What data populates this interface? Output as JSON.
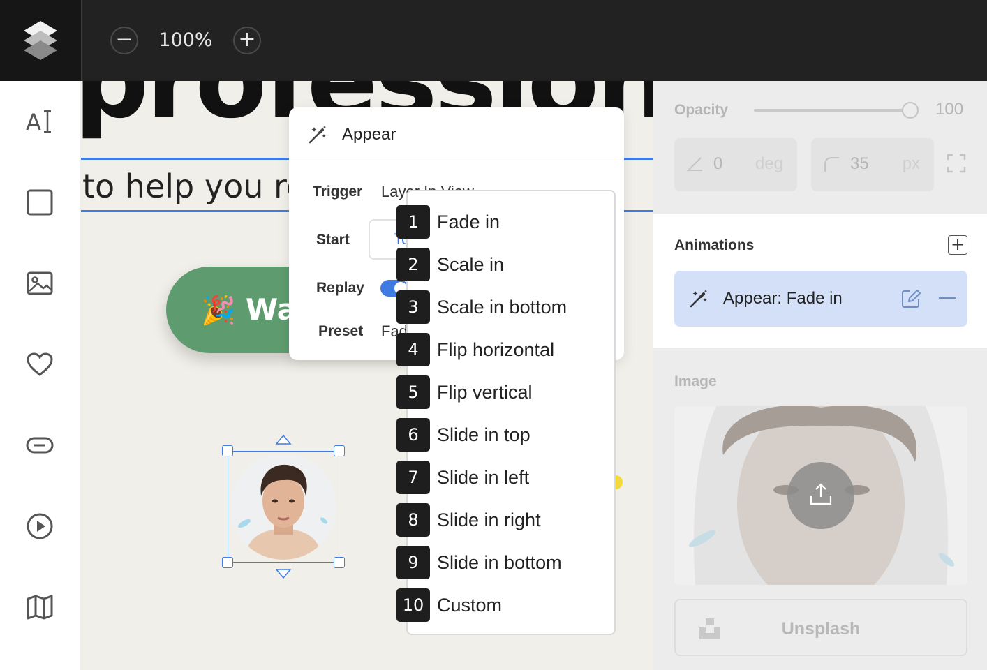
{
  "topbar": {
    "zoom_out": "−",
    "zoom_value": "100%",
    "zoom_in": "+"
  },
  "left_toolbar": {
    "tools": [
      "text-tool",
      "rectangle-tool",
      "image-tool",
      "heart-tool",
      "button-tool",
      "video-tool",
      "map-tool"
    ]
  },
  "canvas": {
    "heading": "profession",
    "subtitle": "to help you reach your goals and",
    "cta_emoji": "🎉",
    "cta_label": "Wa"
  },
  "appear_popup": {
    "title": "Appear",
    "trigger_label": "Trigger",
    "trigger_value": "Layer In View",
    "start_label": "Start",
    "start_value": "To",
    "replay_label": "Replay",
    "replay_on": true,
    "preset_label": "Preset",
    "preset_value": "Fade in"
  },
  "preset_dropdown": {
    "items": [
      {
        "num": "1",
        "label": "Fade in"
      },
      {
        "num": "2",
        "label": "Scale in"
      },
      {
        "num": "3",
        "label": "Scale in bottom"
      },
      {
        "num": "4",
        "label": "Flip horizontal"
      },
      {
        "num": "5",
        "label": "Flip vertical"
      },
      {
        "num": "6",
        "label": "Slide in top"
      },
      {
        "num": "7",
        "label": "Slide in left"
      },
      {
        "num": "8",
        "label": "Slide in right"
      },
      {
        "num": "9",
        "label": "Slide in bottom"
      },
      {
        "num": "10",
        "label": "Custom"
      }
    ]
  },
  "right_panel": {
    "opacity_label": "Opacity",
    "opacity_value": "100",
    "rotation_value": "0",
    "rotation_unit": "deg",
    "radius_value": "35",
    "radius_unit": "px",
    "animations_title": "Animations",
    "animations_add": "+",
    "animation_item": "Appear: Fade in",
    "image_label": "Image",
    "unsplash_label": "Unsplash"
  },
  "colors": {
    "accent": "#3f7be0",
    "cta_green": "#5e9c6f",
    "animation_highlight": "#d3e0f8",
    "topbar": "#222222"
  }
}
